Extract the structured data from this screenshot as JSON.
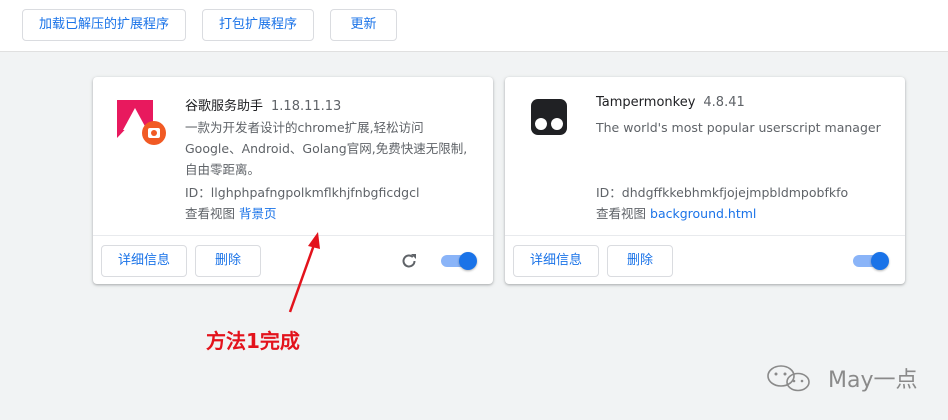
{
  "toolbar": {
    "load_unpacked": "加载已解压的扩展程序",
    "pack_extension": "打包扩展程序",
    "update": "更新"
  },
  "extensions": [
    {
      "name": "谷歌服务助手",
      "version": "1.18.11.13",
      "description_lines": [
        "一款为开发者设计的chrome扩展,轻松访问",
        "Google、Android、Golang官网,免费快速无限制,",
        "自由零距离。"
      ],
      "id_label": "ID：llghphpafngpolkmflkhjfnbgficdgcl",
      "view_label": "查看视图",
      "view_link": "背景页",
      "details_button": "详细信息",
      "remove_button": "删除",
      "enabled": true
    },
    {
      "name": "Tampermonkey",
      "version": "4.8.41",
      "description_lines": [
        "The world's most popular userscript manager"
      ],
      "id_label": "ID：dhdgffkkebhmkfjojejmpbldmpobfkfo",
      "view_label": "查看视图",
      "view_link": "background.html",
      "details_button": "详细信息",
      "remove_button": "删除",
      "enabled": true
    }
  ],
  "annotation": "方法1完成",
  "watermark": "May一点",
  "colors": {
    "accent": "#1a73e8",
    "annotation_red": "#e3131c",
    "google_helper_pink": "#e8195e",
    "google_helper_orange": "#f15a24"
  },
  "icons": {
    "google_helper": "google-helper-logo-icon",
    "tampermonkey": "tampermonkey-logo-icon",
    "reload": "reload-icon",
    "watermark": "wechat-icon"
  }
}
